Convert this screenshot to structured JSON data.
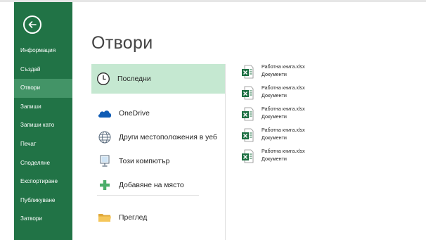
{
  "sidebar": {
    "items": [
      {
        "label": "Информация"
      },
      {
        "label": "Създай"
      },
      {
        "label": "Отвори",
        "active": true
      },
      {
        "label": "Запиши"
      },
      {
        "label": "Запиши като"
      },
      {
        "label": "Печат"
      },
      {
        "label": "Споделяне"
      },
      {
        "label": "Експортиране"
      },
      {
        "label": "Публикуване"
      },
      {
        "label": "Затвори"
      }
    ]
  },
  "main": {
    "title": "Отвори",
    "places": [
      {
        "label": "Последни",
        "icon": "clock-icon",
        "active": true
      },
      {
        "label": "OneDrive",
        "icon": "cloud-icon"
      },
      {
        "label": "Други местоположения в уеб",
        "icon": "globe-icon"
      },
      {
        "label": "Този компютър",
        "icon": "computer-icon"
      },
      {
        "label": "Добавяне на място",
        "icon": "plus-icon"
      },
      {
        "label": "Преглед",
        "icon": "folder-icon"
      }
    ]
  },
  "recent": {
    "files": [
      {
        "name": "Работна книга.xlsx",
        "location": "Документи"
      },
      {
        "name": "Работна книга.xlsx",
        "location": "Документи"
      },
      {
        "name": "Работна книга.xlsx",
        "location": "Документи"
      },
      {
        "name": "Работна книга.xlsx",
        "location": "Документи"
      },
      {
        "name": "Работна книга.xlsx",
        "location": "Документи"
      }
    ]
  },
  "colors": {
    "sidebar": "#217346",
    "sidebar_active": "#439467",
    "place_active": "#c5e8d1"
  }
}
